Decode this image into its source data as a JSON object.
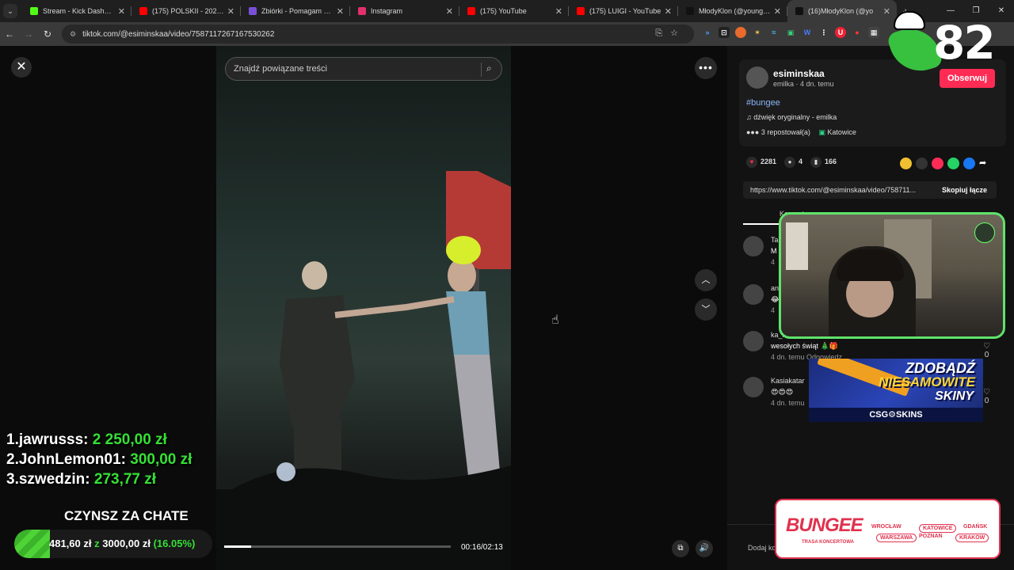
{
  "browser": {
    "tabs": [
      {
        "title": "Stream - Kick Dashboard",
        "color": "#53fc18",
        "active": false
      },
      {
        "title": "(175) POLSKII - 2026 (MU",
        "color": "#ff0000",
        "active": false
      },
      {
        "title": "Zbiórki - Pomagam Canc",
        "color": "#7a4fd8",
        "active": false
      },
      {
        "title": "Instagram",
        "color": "#e1306c",
        "active": false
      },
      {
        "title": "(175) YouTube",
        "color": "#ff0000",
        "active": false
      },
      {
        "title": "(175) LUIGI - YouTube",
        "color": "#ff0000",
        "active": false
      },
      {
        "title": "MłodyKlon (@youngklon)",
        "color": "#111111",
        "active": false
      },
      {
        "title": "(16)MłodyKlon (@yo",
        "color": "#111111",
        "active": true
      }
    ],
    "url": "tiktok.com/@esiminskaa/video/7587117267167530262"
  },
  "video": {
    "search_placeholder": "Znajdź powiązane treści",
    "time": "00:16/02:13",
    "progress": 0.12
  },
  "author": {
    "username": "esiminskaa",
    "subline": "emilka · 4 dn. temu",
    "follow_label": "Obserwuj",
    "hashtag": "#bungee",
    "sound": "dźwięk oryginalny - emilka",
    "reposts": "3 repostował(a)",
    "location": "Katowice"
  },
  "stats": {
    "likes": "2281",
    "comments": "4",
    "saves": "166"
  },
  "link": {
    "url": "https://www.tiktok.com/@esiminskaa/video/758711...",
    "copy_label": "Skopiuj łącze"
  },
  "comments_tab": "Komentarze",
  "comments": [
    {
      "name": "Ta",
      "text": "M",
      "meta": "4",
      "likes": ""
    },
    {
      "name": "an",
      "text": "😂",
      "meta": "4",
      "likes": ""
    },
    {
      "name": "ka_ro",
      "text": "wesołych świąt 🎄🎁",
      "meta": "4 dn. temu    Odpowiedz",
      "likes": "0"
    },
    {
      "name": "Kasiakatar",
      "text": "😍😍😍",
      "meta": "4 dn. temu",
      "likes": "0"
    }
  ],
  "add_comment": "Dodaj ko",
  "overlays": {
    "stream_number": "82",
    "donors": [
      {
        "rank": "1.",
        "name": "jawrusss:",
        "amount": "2 250,00 zł"
      },
      {
        "rank": "2.",
        "name": "JohnLemon01:",
        "amount": "300,00 zł"
      },
      {
        "rank": "3.",
        "name": "szwedzin:",
        "amount": "273,77 zł"
      }
    ],
    "goal_title": "CZYNSZ ZA CHATE",
    "goal_current": "481,60 zł",
    "goal_sep": "z",
    "goal_target": "3000,00 zł",
    "goal_pct": "(16.05%)",
    "goal_fraction": 0.1605,
    "ad_line1": "ZDOBĄDŹ",
    "ad_line2": "NIESAMOWITE",
    "ad_line3": "SKINY",
    "ad_brand": "CSG⚙SKINS",
    "bungee_title": "BUNGEE",
    "bungee_sub": "TRASA KONCERTOWA",
    "bungee_cities": [
      "WROCŁAW",
      "KATOWICE",
      "GDAŃSK",
      "WARSZAWA",
      "POZNAŃ",
      "KRAKÓW"
    ]
  }
}
